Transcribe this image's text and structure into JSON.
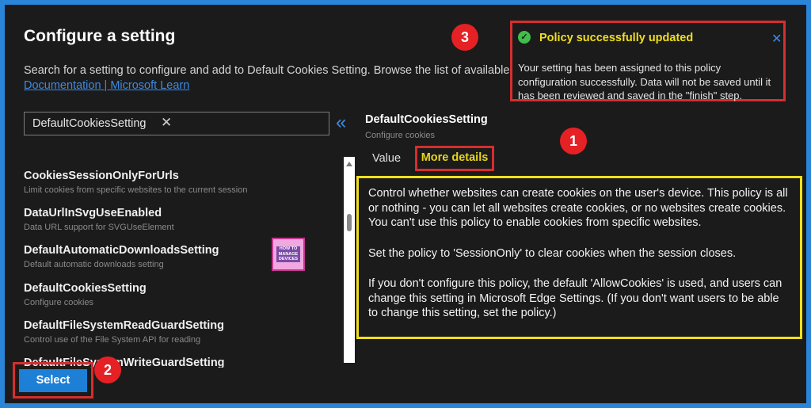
{
  "page": {
    "title": "Configure a setting",
    "description": "Search for a setting to configure and add to Default Cookies Setting. Browse the list of available",
    "doc_link": "Documentation | Microsoft Learn"
  },
  "search": {
    "value": "DefaultCookiesSetting",
    "clear_icon": "close-icon"
  },
  "settings_list": [
    {
      "name": "CookiesSessionOnlyForUrls",
      "description": "Limit cookies from specific websites to the current session"
    },
    {
      "name": "DataUrlInSvgUseEnabled",
      "description": "Data URL support for SVGUseElement"
    },
    {
      "name": "DefaultAutomaticDownloadsSetting",
      "description": "Default automatic downloads setting"
    },
    {
      "name": "DefaultCookiesSetting",
      "description": "Configure cookies"
    },
    {
      "name": "DefaultFileSystemReadGuardSetting",
      "description": "Control use of the File System API for reading"
    },
    {
      "name": "DefaultFileSystemWriteGuardSetting",
      "description": ""
    }
  ],
  "logo": {
    "text": "HOW TO MANAGE DEVICES"
  },
  "details_pane": {
    "title": "DefaultCookiesSetting",
    "subtitle": "Configure cookies",
    "tabs": {
      "value": "Value",
      "more_details": "More details"
    },
    "paragraphs": [
      "Control whether websites can create cookies on the user's device. This policy is all or nothing - you can let all websites create cookies, or no websites create cookies. You can't use this policy to enable cookies from specific websites.",
      "Set the policy to 'SessionOnly' to clear cookies when the session closes.",
      "If you don't configure this policy, the default 'AllowCookies' is used, and users can change this setting in Microsoft Edge Settings. (If you don't want users to be able to change this setting, set the policy.)"
    ]
  },
  "toast": {
    "title": "Policy successfully updated",
    "body": "Your setting has been assigned to this policy configuration successfully. Data will not be saved until it has been reviewed and saved in the \"finish\" step.",
    "close_symbol": "✕",
    "check_symbol": "✓"
  },
  "badges": {
    "one": "1",
    "two": "2",
    "three": "3"
  },
  "footer": {
    "select_label": "Select"
  },
  "colors": {
    "frame": "#2a84d8",
    "panel": "#1b1b1b",
    "accent_blue": "#3e8ae3",
    "highlight_red": "#d52e2e",
    "highlight_yellow": "#f1df1d",
    "success_green": "#3fbf49"
  }
}
